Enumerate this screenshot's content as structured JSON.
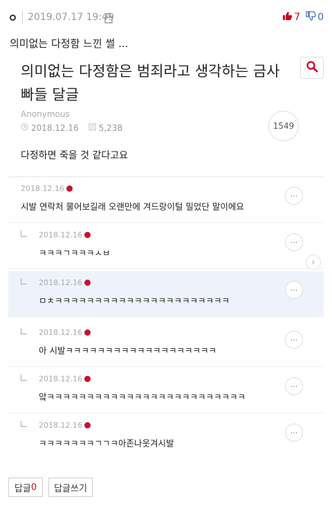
{
  "post": {
    "date": "2019.07.17 19:49",
    "upvotes": "7",
    "downvotes": "0",
    "title": "의미없는 다정함 느낀 썰 ..."
  },
  "screenshot": {
    "title": "의미없는 다정함은 범죄라고 생각하는 금사빠들 달글",
    "author": "Anonymous",
    "date": "2018.12.16",
    "views": "5,238",
    "comment_count": "1549",
    "body": "다정하면 죽을 것 같다고요",
    "comments": [
      {
        "date": "2018.12.16",
        "text": "시발 연락처 물어보길래 오랜만에 겨드랑이털 밀었단 말이에요",
        "reply": false,
        "highlight": false
      },
      {
        "date": "2018.12.16",
        "text": "ㅋㅋㅋㄱㅋㅋㅋㅅㅂ",
        "reply": true,
        "highlight": false
      },
      {
        "date": "2018.12.16",
        "text": "ㅁㅊㅋㅋㅋㅋㅋㅋㅋㅋㅋㅋㅋㅋㅋㅋㅋㅋㅋㅋㅋㅋㅋㅋ",
        "reply": true,
        "highlight": true
      },
      {
        "date": "2018.12.16",
        "text": "아 시발ㅋㅋㅋㅋㅋㅋㅋㅋㅋㅋㅋㅋㅋㅋㅋㅋㅋㅋㅋ",
        "reply": true,
        "highlight": false
      },
      {
        "date": "2018.12.16",
        "text": "앜ㅋㅋㅋㅋㅋㅋㅋㅋㅋㅋㅋㅋㅋㅋㅋㅋㅋㅋㅋㅋㅋㅋㅋㅋㅋ",
        "reply": true,
        "highlight": false
      },
      {
        "date": "2018.12.16",
        "text": "ㅋㅋㅋㅋㅋㅋㅋㄱㄱㅋ아존나웃겨시발",
        "reply": true,
        "highlight": false
      }
    ],
    "more_label": "···"
  },
  "footer": {
    "reply_label": "답글",
    "reply_count": "0",
    "write_reply_label": "답글쓰기"
  },
  "colors": {
    "upvote": "#d0021b",
    "downvote": "#3b68b0",
    "highlight_row": "#eef3fb"
  }
}
